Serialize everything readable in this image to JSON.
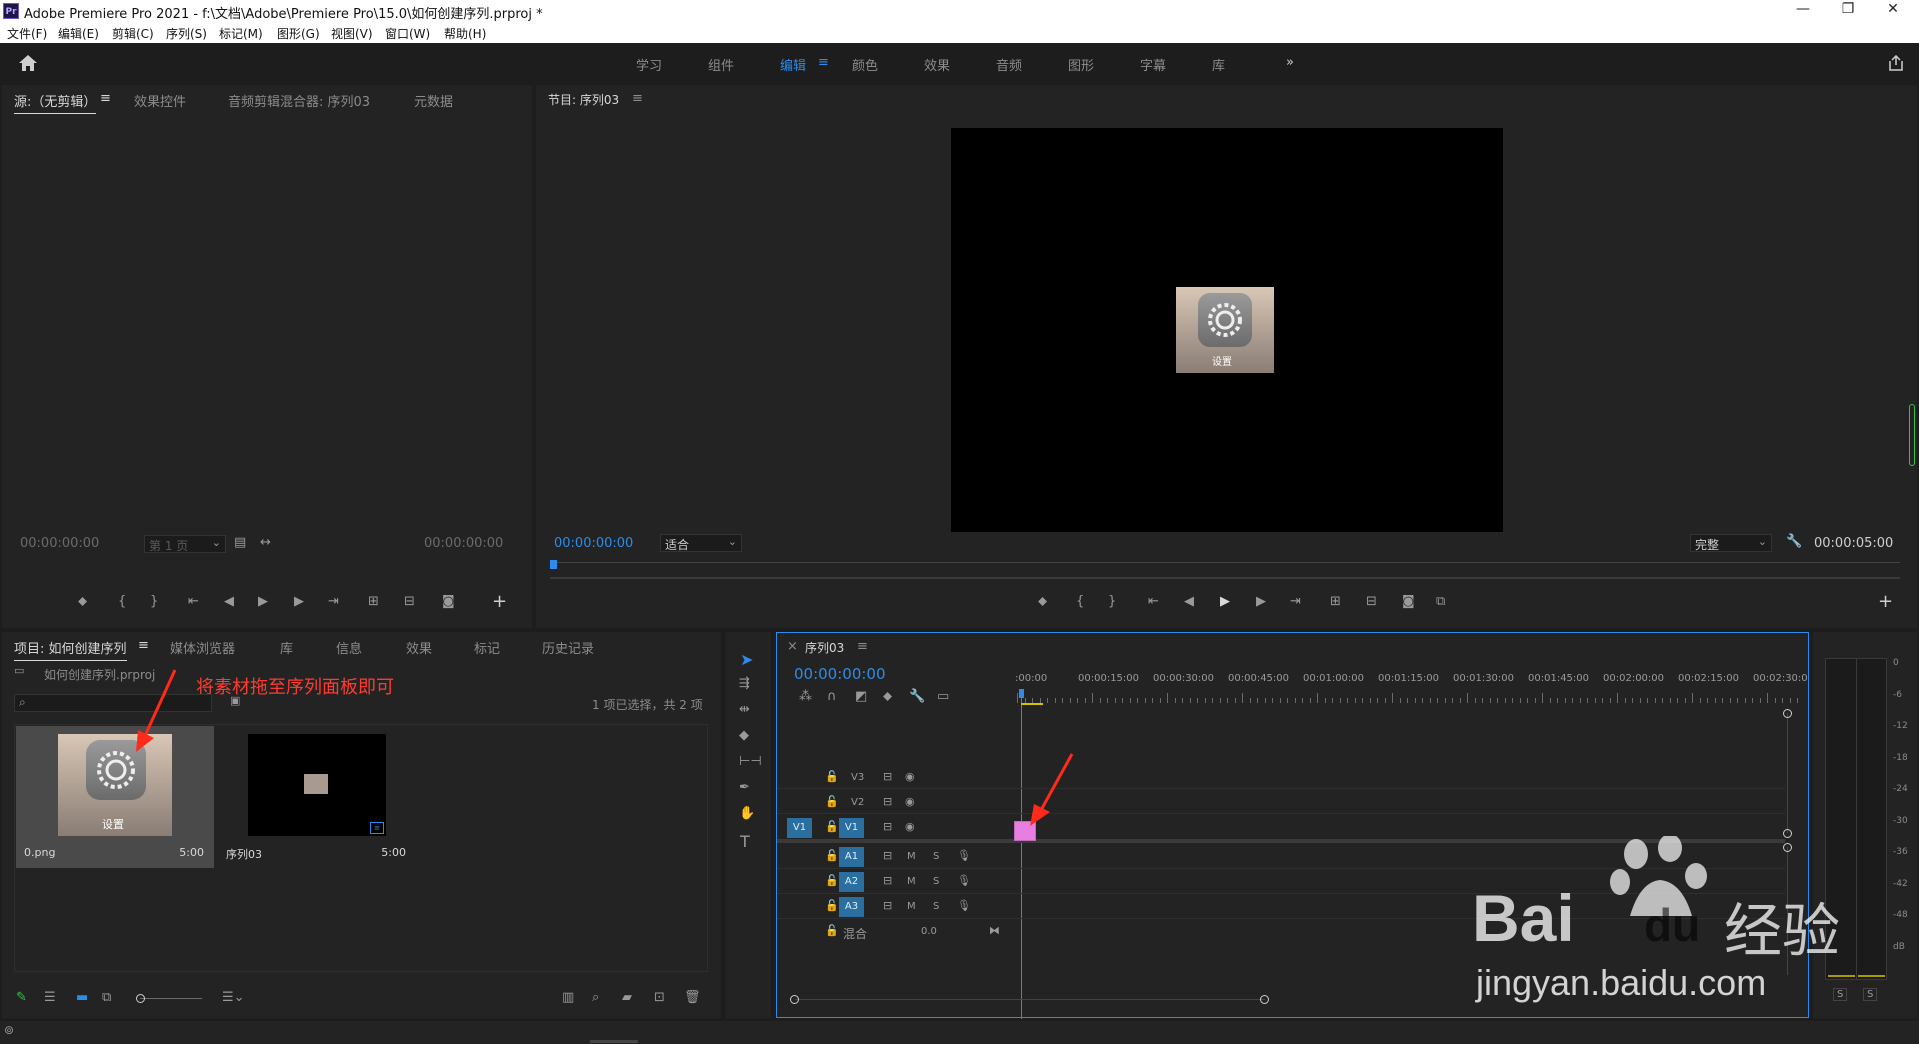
{
  "window": {
    "app_badge": "Pr",
    "title": "Adobe Premiere Pro 2021 - f:\\文档\\Adobe\\Premiere Pro\\15.0\\如何创建序列.prproj *",
    "controls": [
      "—",
      "❐",
      "✕"
    ]
  },
  "menu": [
    "文件(F)",
    "编辑(E)",
    "剪辑(C)",
    "序列(S)",
    "标记(M)",
    "图形(G)",
    "视图(V)",
    "窗口(W)",
    "帮助(H)"
  ],
  "workspaces": {
    "items": [
      "学习",
      "组件",
      "编辑",
      "颜色",
      "效果",
      "音频",
      "图形",
      "字幕",
      "库"
    ],
    "active": "编辑",
    "menu_glyph": "≡",
    "more": "»"
  },
  "source_panel": {
    "tabs": [
      "源:（无剪辑）",
      "效果控件",
      "音频剪辑混合器: 序列03",
      "元数据"
    ],
    "active_tab": "源:（无剪辑）",
    "timecode_left": "00:00:00:00",
    "page_select": "第 1 页",
    "timecode_right": "00:00:00:00"
  },
  "program_panel": {
    "title": "节目: 序列03",
    "timecode": "00:00:00:00",
    "fit_select": "适合",
    "quality_select": "完整",
    "duration": "00:00:05:00",
    "frame_caption": "设置"
  },
  "project_panel": {
    "tabs": [
      "项目: 如何创建序列",
      "媒体浏览器",
      "库",
      "信息",
      "效果",
      "标记",
      "历史记录"
    ],
    "active_tab": "项目: 如何创建序列",
    "project_file": "如何创建序列.prproj",
    "annotation": "将素材拖至序列面板即可",
    "selection_info": "1 项已选择，共 2 项",
    "items": [
      {
        "name": "0.png",
        "duration": "5:00",
        "caption": "设置"
      },
      {
        "name": "序列03",
        "duration": "5:00"
      }
    ]
  },
  "timeline": {
    "title": "序列03",
    "close_glyph": "×",
    "timecode": "00:00:00:00",
    "ruler": [
      ":00:00",
      "00:00:15:00",
      "00:00:30:00",
      "00:00:45:00",
      "00:01:00:00",
      "00:01:15:00",
      "00:01:30:00",
      "00:01:45:00",
      "00:02:00:00",
      "00:02:15:00",
      "00:02:30:0"
    ],
    "video_tracks": [
      "V3",
      "V2",
      "V1"
    ],
    "source_patch": "V1",
    "audio_tracks": [
      "A1",
      "A2",
      "A3"
    ],
    "mute_label": "M",
    "solo_label": "S",
    "mix_label": "混合",
    "mix_value": "0.0",
    "clip_color": "#e87fe0"
  },
  "meter": {
    "scale": [
      "0",
      "-6",
      "-12",
      "-18",
      "-24",
      "-30",
      "-36",
      "-42",
      "-48",
      "dB"
    ],
    "solo_buttons": [
      "S",
      "S"
    ]
  },
  "watermark": {
    "logo_text": "Bai",
    "logo_text_2": "du",
    "logo_cn": "经验",
    "url": "jingyan.baidu.com"
  },
  "colors": {
    "accent": "#2d8ceb",
    "panel_bg": "#232323",
    "annotation": "#ff3b30",
    "clip": "#e87fe0"
  }
}
